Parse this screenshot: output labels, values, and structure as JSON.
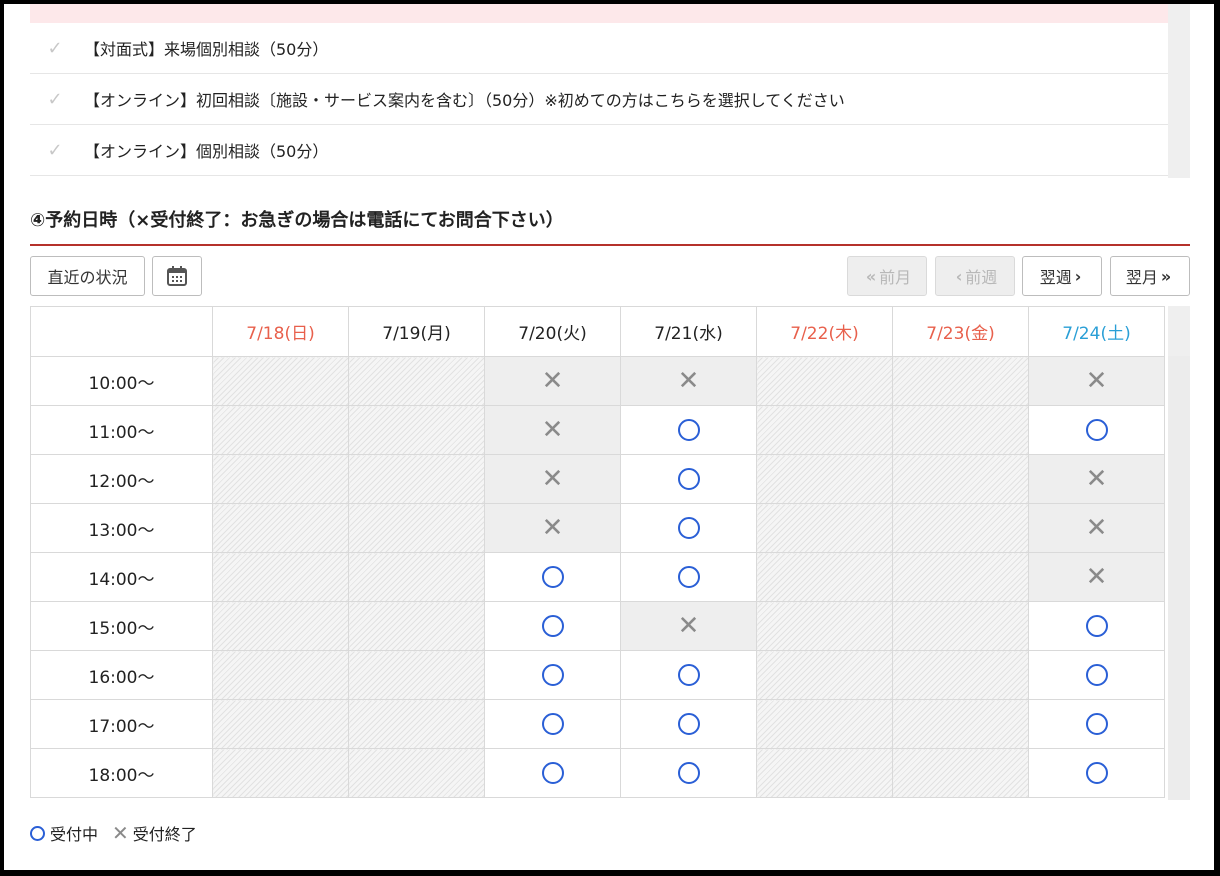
{
  "plans": [
    {
      "label": "【対面式】来場個別相談（50分）"
    },
    {
      "label": "【オンライン】初回相談〔施設・サービス案内を含む〕（50分）※初めての方はこちらを選択してください"
    },
    {
      "label": "【オンライン】個別相談（50分）"
    }
  ],
  "section_title": "④予約日時（×受付終了：お急ぎの場合は電話にてお問合下さい）",
  "toolbar": {
    "recent_label": "直近の状況",
    "prev_month_label": "前月",
    "prev_week_label": "前週",
    "next_week_label": "翌週",
    "next_month_label": "翌月"
  },
  "days": [
    {
      "label": "7/18(日)",
      "color": "#e8604c"
    },
    {
      "label": "7/19(月)",
      "color": "#222222"
    },
    {
      "label": "7/20(火)",
      "color": "#222222"
    },
    {
      "label": "7/21(水)",
      "color": "#222222"
    },
    {
      "label": "7/22(木)",
      "color": "#e8604c"
    },
    {
      "label": "7/23(金)",
      "color": "#e8604c"
    },
    {
      "label": "7/24(土)",
      "color": "#2a9fd6"
    }
  ],
  "rows": [
    {
      "time": "10:00〜",
      "slots": [
        "na",
        "na",
        "closed",
        "closed",
        "na",
        "na",
        "closed"
      ]
    },
    {
      "time": "11:00〜",
      "slots": [
        "na",
        "na",
        "closed",
        "open",
        "na",
        "na",
        "open"
      ]
    },
    {
      "time": "12:00〜",
      "slots": [
        "na",
        "na",
        "closed",
        "open",
        "na",
        "na",
        "closed"
      ]
    },
    {
      "time": "13:00〜",
      "slots": [
        "na",
        "na",
        "closed",
        "open",
        "na",
        "na",
        "closed"
      ]
    },
    {
      "time": "14:00〜",
      "slots": [
        "na",
        "na",
        "open",
        "open",
        "na",
        "na",
        "closed"
      ]
    },
    {
      "time": "15:00〜",
      "slots": [
        "na",
        "na",
        "open",
        "closed",
        "na",
        "na",
        "open"
      ]
    },
    {
      "time": "16:00〜",
      "slots": [
        "na",
        "na",
        "open",
        "open",
        "na",
        "na",
        "open"
      ]
    },
    {
      "time": "17:00〜",
      "slots": [
        "na",
        "na",
        "open",
        "open",
        "na",
        "na",
        "open"
      ]
    },
    {
      "time": "18:00〜",
      "slots": [
        "na",
        "na",
        "open",
        "open",
        "na",
        "na",
        "open"
      ]
    }
  ],
  "legend": {
    "open_label": "受付中",
    "closed_label": "受付終了"
  },
  "colors": {
    "accent_rule": "#b5312b",
    "open_circle": "#2a5fd6",
    "sunday": "#e8604c",
    "saturday": "#2a9fd6"
  }
}
